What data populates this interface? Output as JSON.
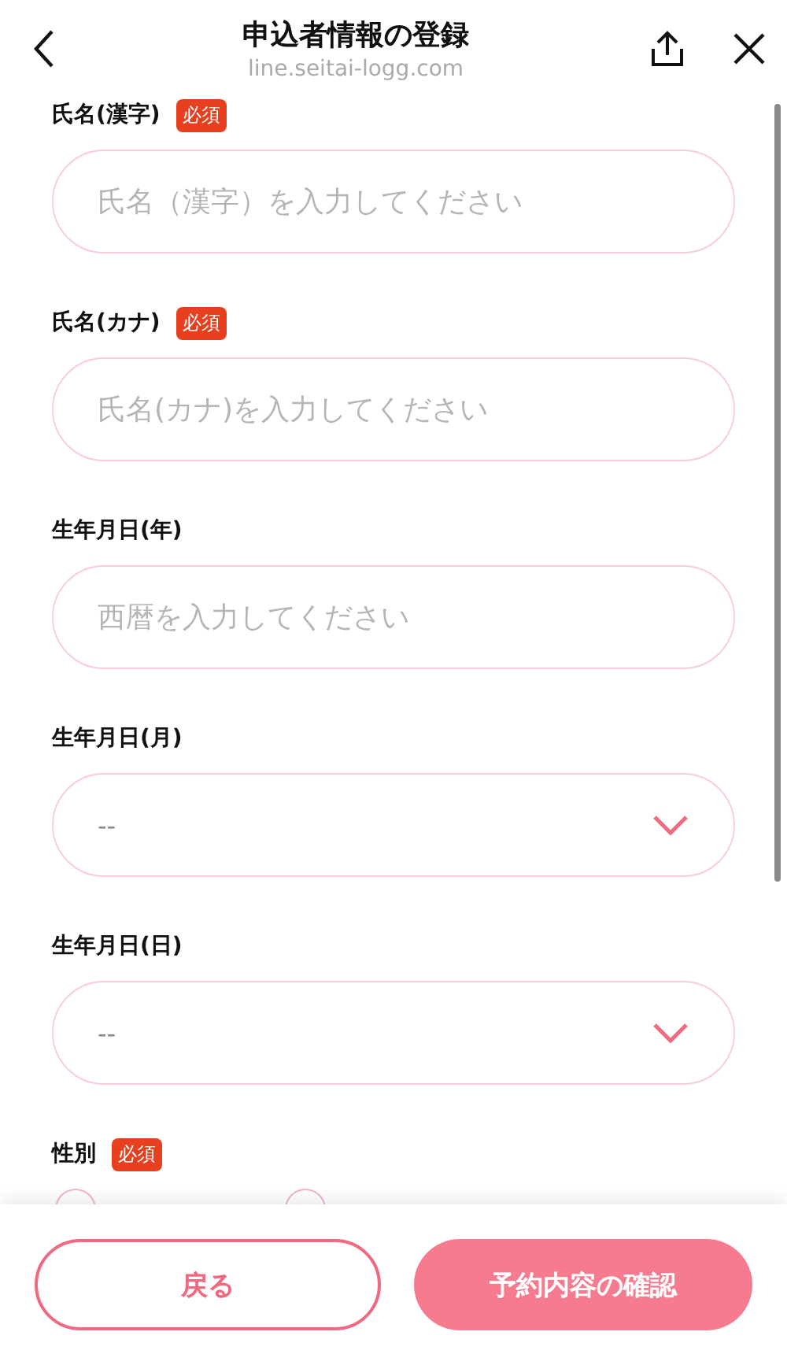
{
  "header": {
    "title": "申込者情報の登録",
    "url": "line.seitai-logg.com"
  },
  "fields": [
    {
      "kind": "text",
      "label": "氏名(漢字)",
      "badge": "必須",
      "placeholder": "氏名（漢字）を入力してください"
    },
    {
      "kind": "text",
      "label": "氏名(カナ)",
      "badge": "必須",
      "placeholder": "氏名(カナ)を入力してください"
    },
    {
      "kind": "text",
      "label": "生年月日(年)",
      "placeholder": "西暦を入力してください"
    },
    {
      "kind": "select",
      "label": "生年月日(月)",
      "value": "--"
    },
    {
      "kind": "select",
      "label": "生年月日(日)",
      "value": "--"
    },
    {
      "kind": "radio",
      "label": "性別",
      "badge": "必須",
      "options": [
        {
          "selected": false
        },
        {
          "selected": false
        }
      ]
    }
  ],
  "buttons": [
    {
      "kind": "secondary",
      "label": "戻る"
    },
    {
      "kind": "primary",
      "label": "予約内容の確認"
    }
  ]
}
